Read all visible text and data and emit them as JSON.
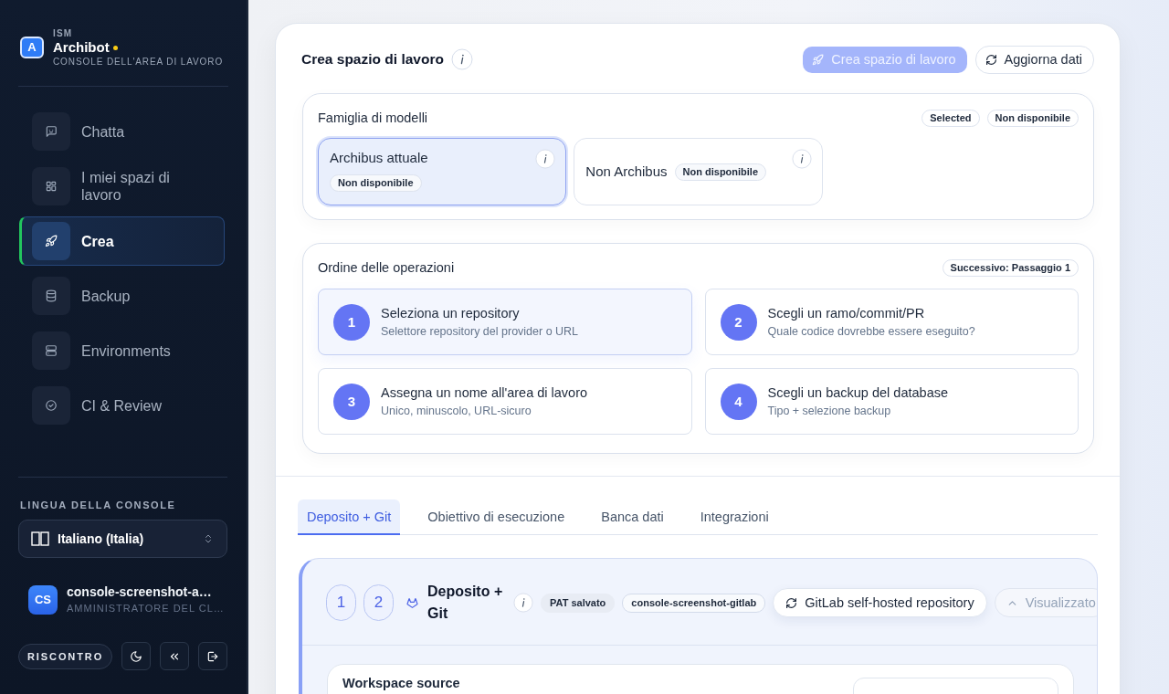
{
  "sidebar": {
    "brand": {
      "logo_letter": "A",
      "org": "ISM",
      "name": "Archibot",
      "subtitle": "CONSOLE DELL'AREA DI LAVORO"
    },
    "nav": [
      {
        "label": "Chatta",
        "selected": false
      },
      {
        "label": "I miei spazi di lavoro",
        "selected": false
      },
      {
        "label": "Crea",
        "selected": true
      },
      {
        "label": "Backup",
        "selected": false
      },
      {
        "label": "Environments",
        "selected": false
      },
      {
        "label": "CI & Review",
        "selected": false
      }
    ],
    "language": {
      "label": "LINGUA DELLA CONSOLE",
      "value": "Italiano (Italia)"
    },
    "user": {
      "initials": "CS",
      "name": "console-screenshot-a…",
      "role": "AMMINISTRATORE DEL CL…"
    },
    "feedback_button": "RISCONTRO"
  },
  "header": {
    "title": "Crea spazio di lavoro",
    "create_button": {
      "label": "Crea spazio di lavoro",
      "disabled": true
    },
    "refresh_button": "Aggiorna dati"
  },
  "model_family": {
    "title": "Famiglia di modelli",
    "badges": [
      "Selected",
      "Non disponibile"
    ],
    "options": [
      {
        "label": "Archibus attuale",
        "badge": "Non disponibile",
        "selected": true
      },
      {
        "label": "Non Archibus",
        "badge": "Non disponibile",
        "selected": false
      }
    ]
  },
  "operations": {
    "title": "Ordine delle operazioni",
    "badge": "Successivo: Passaggio 1",
    "steps": [
      {
        "number": "1",
        "title": "Seleziona un repository",
        "subtitle": "Selettore repository del provider o URL",
        "selected": true
      },
      {
        "number": "2",
        "title": "Scegli un ramo/commit/PR",
        "subtitle": "Quale codice dovrebbe essere eseguito?",
        "selected": false
      },
      {
        "number": "3",
        "title": "Assegna un nome all'area di lavoro",
        "subtitle": "Unico, minuscolo, URL-sicuro",
        "selected": false
      },
      {
        "number": "4",
        "title": "Scegli un backup del database",
        "subtitle": "Tipo + selezione backup",
        "selected": false
      }
    ]
  },
  "tabs": [
    {
      "label": "Deposito + Git",
      "selected": true
    },
    {
      "label": "Obiettivo di esecuzione",
      "selected": false
    },
    {
      "label": "Banca dati",
      "selected": false
    },
    {
      "label": "Integrazioni",
      "selected": false
    }
  ],
  "repo_section": {
    "step_badges": [
      "1",
      "2"
    ],
    "title": "Deposito + Git",
    "badges": [
      {
        "label": "PAT salvato",
        "kind": "plain"
      },
      {
        "label": "console-screenshot-gitlab",
        "kind": "outlined"
      }
    ],
    "provider_button": "GitLab self-hosted repository",
    "toggle_button": "Visualizzato",
    "source_card": {
      "title": "Workspace source"
    }
  }
}
